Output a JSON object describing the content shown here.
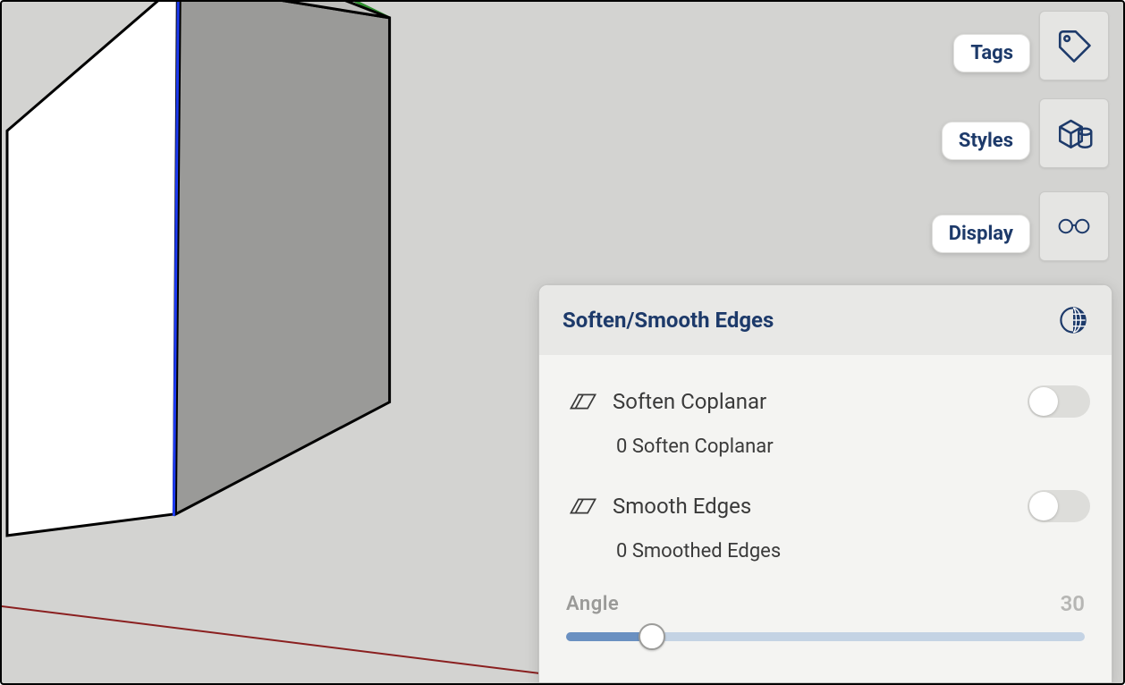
{
  "side": {
    "tags_label": "Tags",
    "styles_label": "Styles",
    "display_label": "Display"
  },
  "panel": {
    "title": "Soften/Smooth Edges",
    "soften_label": "Soften Coplanar",
    "soften_status": "0 Soften Coplanar",
    "soften_on": false,
    "smooth_label": "Smooth Edges",
    "smooth_status": "0 Smoothed Edges",
    "smooth_on": false,
    "angle_label": "Angle",
    "angle_value": "30"
  }
}
